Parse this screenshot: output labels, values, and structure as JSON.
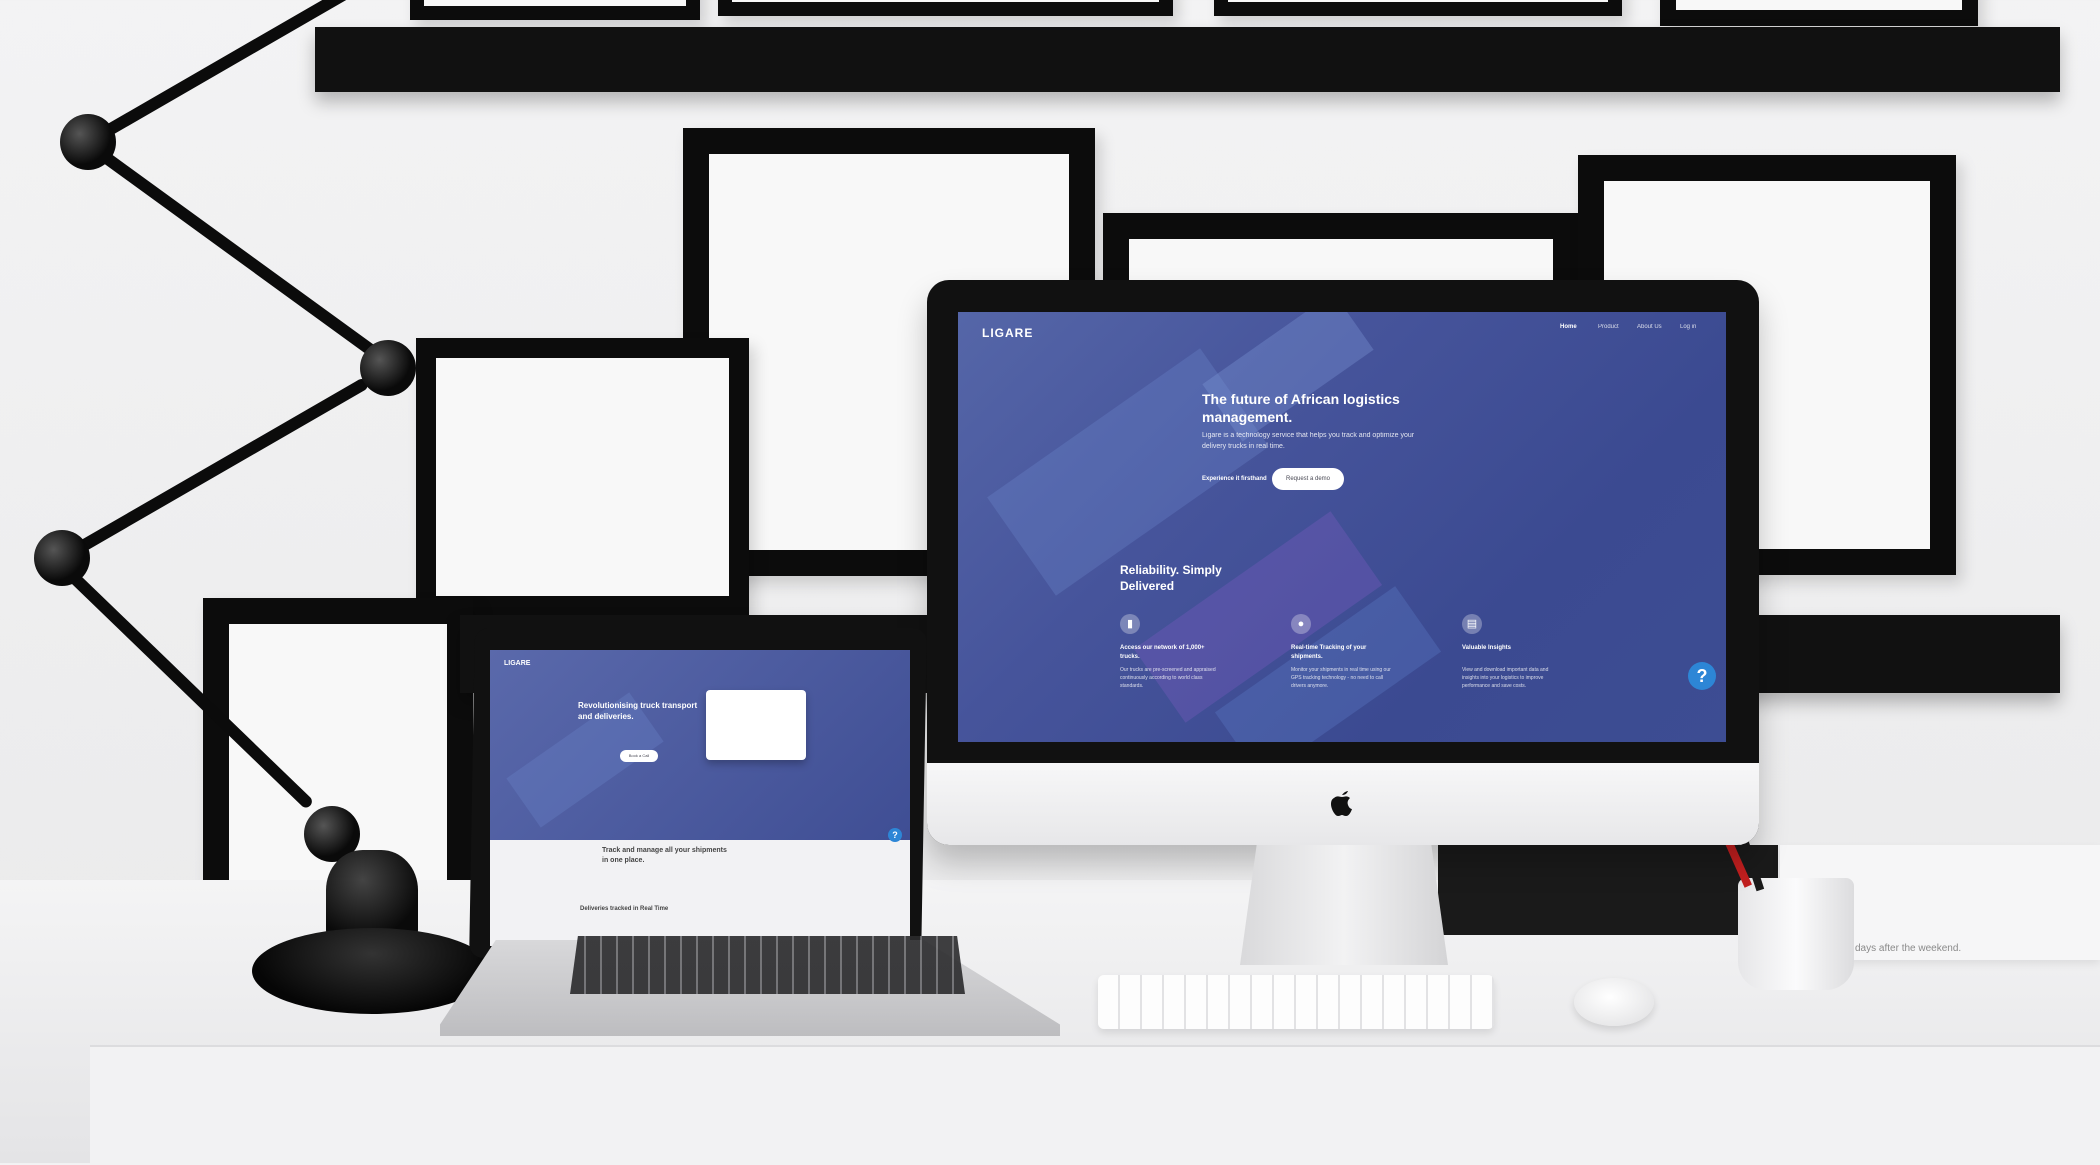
{
  "imac_site": {
    "logo": "LIGARE",
    "nav": [
      "Home",
      "Product",
      "About Us",
      "Log in"
    ],
    "hero_title": "The future of African logistics management.",
    "hero_text": "Ligare is a technology service that helps you track and optimize your delivery trucks in real time.",
    "cta_link": "Experience it firsthand",
    "cta_button": "Request a demo",
    "section_title": "Reliability. Simply Delivered",
    "features": [
      {
        "title": "Access our network of 1,000+ trucks.",
        "text": "Our trucks are pre-screened and appraised continuously according to world class standards.",
        "icon": "truck-icon"
      },
      {
        "title": "Real-time Tracking of your shipments.",
        "text": "Monitor your shipments in real time using our GPS tracking technology - no need to call drivers anymore.",
        "icon": "location-pin-icon"
      },
      {
        "title": "Valuable Insights",
        "text": "View and download important data and insights into your logistics to improve performance and save costs.",
        "icon": "document-icon"
      }
    ],
    "help": "?"
  },
  "laptop_site": {
    "logo": "LIGARE",
    "hero_title": "Revolutionising truck transport and deliveries.",
    "cta_button": "Book a Call",
    "section_title": "Track and manage all your shipments in one place.",
    "feature_title": "Deliveries tracked in Real Time",
    "help": "?"
  },
  "desk_note": "days after the weekend.",
  "colors": {
    "hero_blue": "#3f4e94",
    "help_blue": "#2d86d6"
  }
}
